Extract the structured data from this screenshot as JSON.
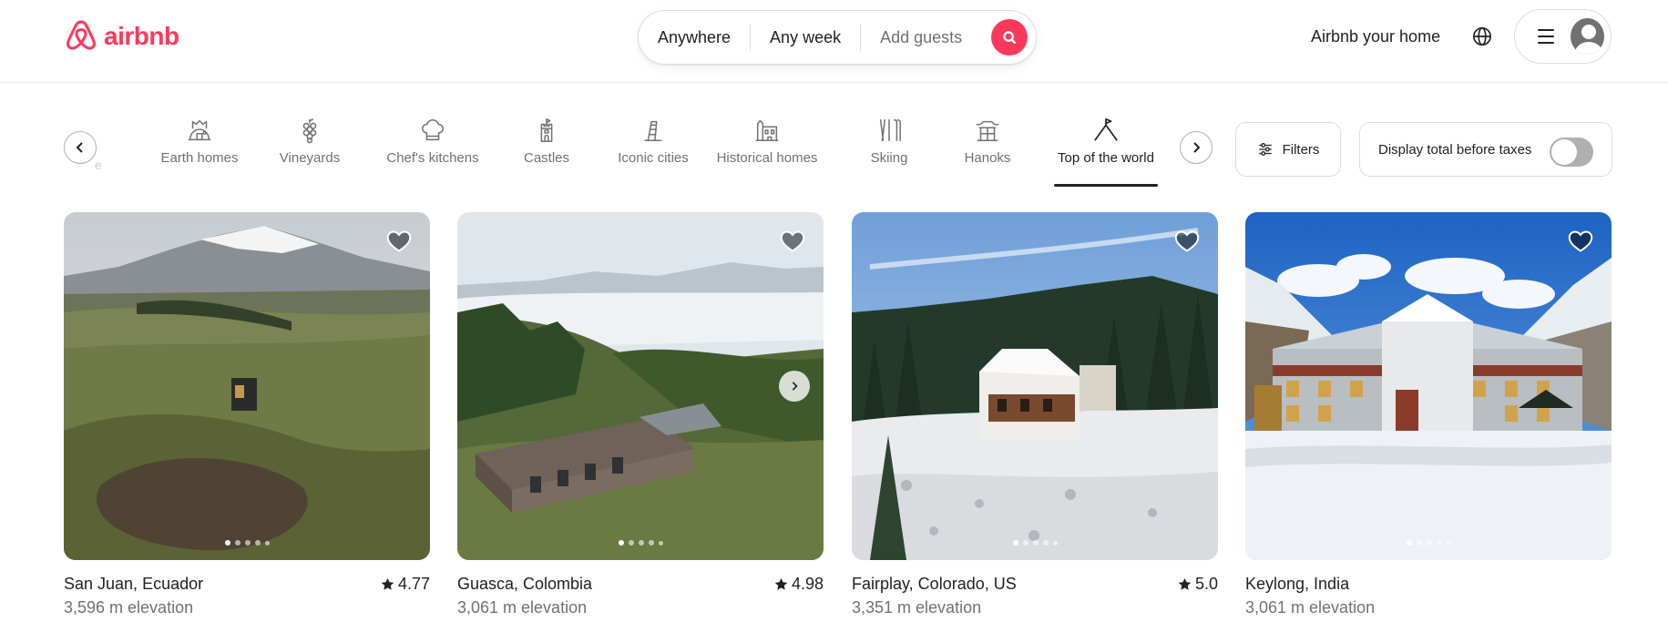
{
  "header": {
    "brand": "airbnb",
    "search": {
      "where": "Anywhere",
      "when": "Any week",
      "guests": "Add guests"
    },
    "host_link": "Airbnb your home"
  },
  "categories": [
    {
      "label": "Earth homes",
      "icon": "earth-home-icon"
    },
    {
      "label": "Vineyards",
      "icon": "grapes-icon"
    },
    {
      "label": "Chef's kitchens",
      "icon": "chef-hat-icon"
    },
    {
      "label": "Castles",
      "icon": "castle-icon"
    },
    {
      "label": "Iconic cities",
      "icon": "leaning-tower-icon"
    },
    {
      "label": "Historical homes",
      "icon": "historic-building-icon"
    },
    {
      "label": "Skiing",
      "icon": "ski-icon"
    },
    {
      "label": "Hanoks",
      "icon": "hanok-icon"
    },
    {
      "label": "Top of the world",
      "icon": "mountain-flag-icon",
      "active": true
    }
  ],
  "filters_label": "Filters",
  "taxes_label": "Display total before taxes",
  "listings": [
    {
      "location": "San Juan, Ecuador",
      "rating": "4.77",
      "elevation": "3,596 m elevation"
    },
    {
      "location": "Guasca, Colombia",
      "rating": "4.98",
      "elevation": "3,061 m elevation"
    },
    {
      "location": "Fairplay, Colorado, US",
      "rating": "5.0",
      "elevation": "3,351 m elevation"
    },
    {
      "location": "Keylong, India",
      "rating": "",
      "elevation": "3,061 m elevation"
    }
  ],
  "colors": {
    "brand": "#ff385c",
    "text": "#222222",
    "muted": "#717171"
  }
}
